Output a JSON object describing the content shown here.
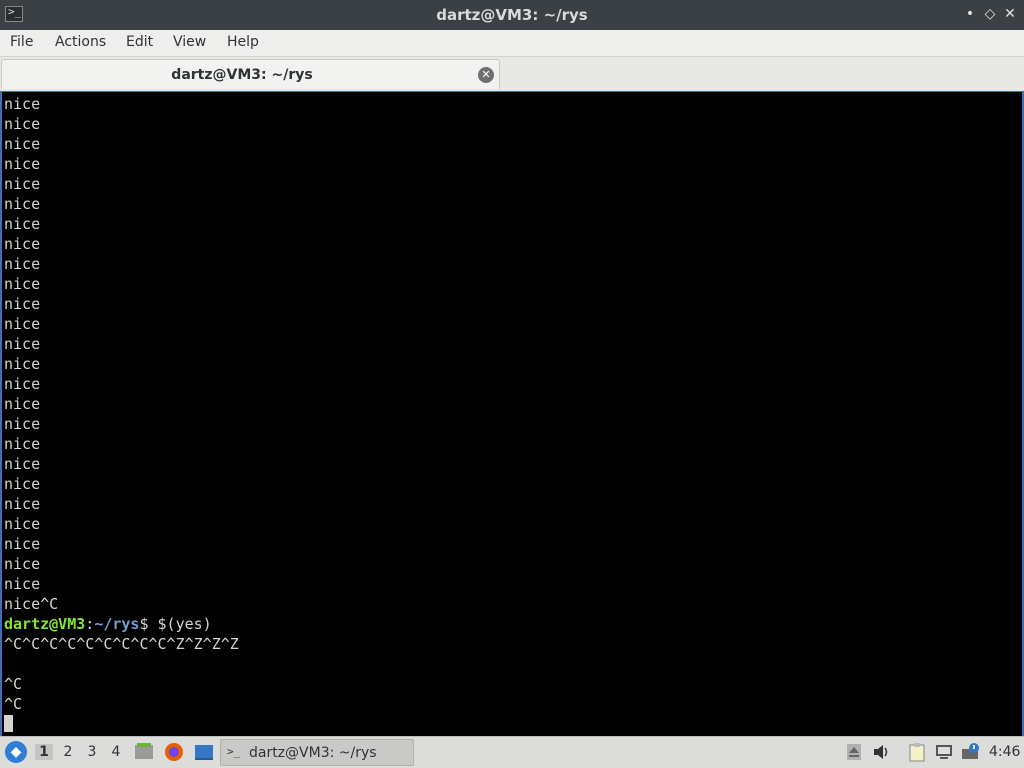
{
  "window": {
    "title": "dartz@VM3: ~/rys",
    "app_icon": ">_",
    "minimize": "•",
    "maximize": "◇",
    "close": "✕"
  },
  "menu": [
    "File",
    "Actions",
    "Edit",
    "View",
    "Help"
  ],
  "tab": {
    "label": "dartz@VM3: ~/rys",
    "close_icon": "✕"
  },
  "terminal": {
    "output_lines": [
      "nice",
      "nice",
      "nice",
      "nice",
      "nice",
      "nice",
      "nice",
      "nice",
      "nice",
      "nice",
      "nice",
      "nice",
      "nice",
      "nice",
      "nice",
      "nice",
      "nice",
      "nice",
      "nice",
      "nice",
      "nice",
      "nice",
      "nice",
      "nice",
      "nice",
      "nice^C"
    ],
    "prompt_user": "dartz@VM3",
    "prompt_colon": ":",
    "prompt_path": "~/rys",
    "prompt_command": "$ $(yes)",
    "after_lines": [
      "^C^C^C^C^C^C^C^C^C^Z^Z^Z^Z",
      "",
      "^C",
      "^C"
    ]
  },
  "taskbar": {
    "workspaces": [
      "1",
      "2",
      "3",
      "4"
    ],
    "active_workspace": "1",
    "task_label": "dartz@VM3: ~/rys",
    "clock": "4:46",
    "accent_color": "#3f6fb5"
  }
}
